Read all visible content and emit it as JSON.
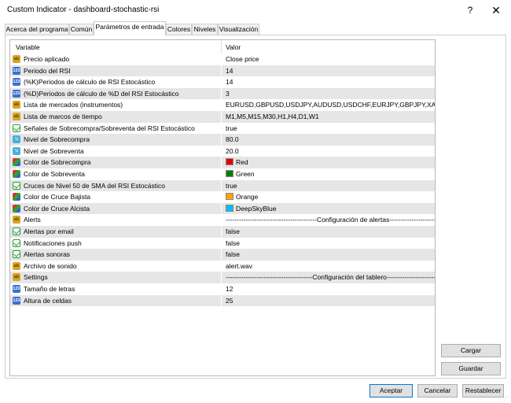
{
  "window": {
    "title": "Custom Indicator - dashboard-stochastic-rsi",
    "help_label": "?",
    "close_label": "✕"
  },
  "tabs": [
    {
      "label": "Acerca del programa"
    },
    {
      "label": "Común"
    },
    {
      "label": "Parámetros de entrada"
    },
    {
      "label": "Colores"
    },
    {
      "label": "Niveles"
    },
    {
      "label": "Visualización"
    }
  ],
  "grid": {
    "header_variable": "Variable",
    "header_value": "Valor",
    "rows": [
      {
        "icon": "ab-icon",
        "name": "Precio aplicado",
        "value": "Close price"
      },
      {
        "icon": "123-icon",
        "name": "Periodo del RSI",
        "value": "14"
      },
      {
        "icon": "123-icon",
        "name": "(%K)Periodos de cálculo de RSI Estocástico",
        "value": "14"
      },
      {
        "icon": "123-icon",
        "name": "(%D)Periodos de cálculo de %D del RSI Estocástico",
        "value": "3"
      },
      {
        "icon": "ab-icon",
        "name": "Lista de mercados (instrumentos)",
        "value": "EURUSD,GBPUSD,USDJPY,AUDUSD,USDCHF,EURJPY,GBPJPY,XAU..."
      },
      {
        "icon": "ab-icon",
        "name": "Lista de marcos de tiempo",
        "value": "M1,M5,M15,M30,H1,H4,D1,W1"
      },
      {
        "icon": "bool-icon",
        "name": "Señales de Sobrecompra/Sobreventa del RSI Estocástico",
        "value": "true"
      },
      {
        "icon": "double-icon",
        "name": "Nivel de Sobrecompra",
        "value": "80.0"
      },
      {
        "icon": "double-icon",
        "name": "Nivel de Sobreventa",
        "value": "20.0"
      },
      {
        "icon": "color-icon",
        "name": "Color de Sobrecompra",
        "value": "Red",
        "swatch": "#e60000"
      },
      {
        "icon": "color-icon",
        "name": "Color de Sobreventa",
        "value": "Green",
        "swatch": "#008000"
      },
      {
        "icon": "bool-icon",
        "name": "Cruces de Nivel 50 de SMA del RSI Estocástico",
        "value": "true"
      },
      {
        "icon": "color-icon",
        "name": "Color de Cruce Bajista",
        "value": "Orange",
        "swatch": "#ffa500"
      },
      {
        "icon": "color-icon",
        "name": "Color de Cruce Alcista",
        "value": "DeepSkyBlue",
        "swatch": "#00bfff"
      },
      {
        "icon": "ab-icon",
        "name": "Alerts",
        "value": "-----------------------------------------Configuración de alertas---------------------------------------"
      },
      {
        "icon": "bool-icon",
        "name": "Alertas por email",
        "value": "false"
      },
      {
        "icon": "bool-icon",
        "name": "Notificaciones push",
        "value": "false"
      },
      {
        "icon": "bool-icon",
        "name": "Alertas sonoras",
        "value": "false"
      },
      {
        "icon": "ab-icon",
        "name": "Archivo de sonido",
        "value": "alert.wav"
      },
      {
        "icon": "ab-icon",
        "name": "Settings",
        "value": "---------------------------------------Configuración del tablero---------------------------------------"
      },
      {
        "icon": "123-icon",
        "name": "Tamaño de letras",
        "value": "12"
      },
      {
        "icon": "123-icon",
        "name": "Altura de celdas",
        "value": "25"
      }
    ]
  },
  "side_buttons": {
    "load": "Cargar",
    "save": "Guardar"
  },
  "bottom_buttons": {
    "accept": "Aceptar",
    "cancel": "Cancelar",
    "reset": "Restablecer"
  }
}
